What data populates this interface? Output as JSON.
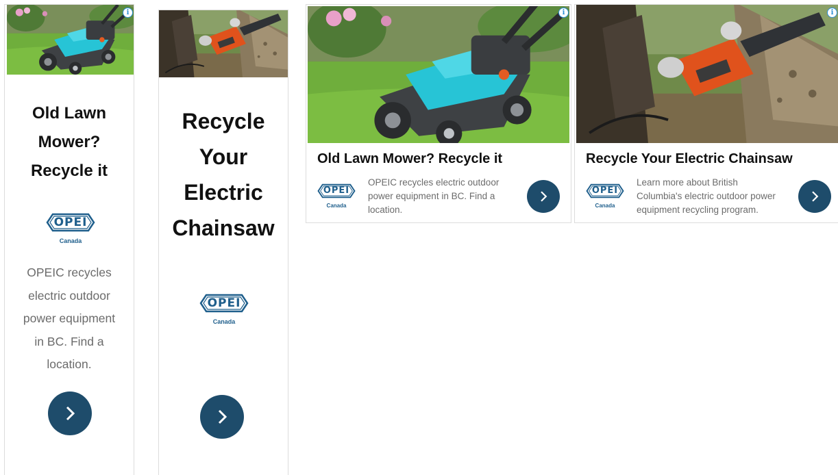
{
  "ads": {
    "lawn_vertical": {
      "title_lines": [
        "Old Lawn",
        "Mower?",
        "Recycle it"
      ],
      "body_lines": [
        "OPEIC recycles",
        "electric outdoor",
        "power equipment",
        "in BC. Find a",
        "location."
      ]
    },
    "chainsaw_vertical": {
      "title_lines": [
        "Recycle",
        "Your",
        "Electric",
        "Chainsaw"
      ]
    },
    "lawn_horizontal": {
      "title": "Old Lawn Mower? Recycle it",
      "body_lines": [
        "OPEIC recycles electric outdoor",
        "power equipment in BC. Find a",
        "location."
      ]
    },
    "chainsaw_horizontal": {
      "title": "Recycle Your Electric Chainsaw",
      "body_lines": [
        "Learn more about British",
        "Columbia's electric outdoor power",
        "equipment recycling program."
      ]
    }
  },
  "logo": {
    "wordmark": "OPEI",
    "country": "Canada"
  },
  "info_icon_glyph": "i",
  "colors": {
    "button": "#1e4c6b",
    "logo": "#1f5f8c",
    "info": "#2b8fd6",
    "title": "#111111",
    "body": "#6b6b6b"
  }
}
